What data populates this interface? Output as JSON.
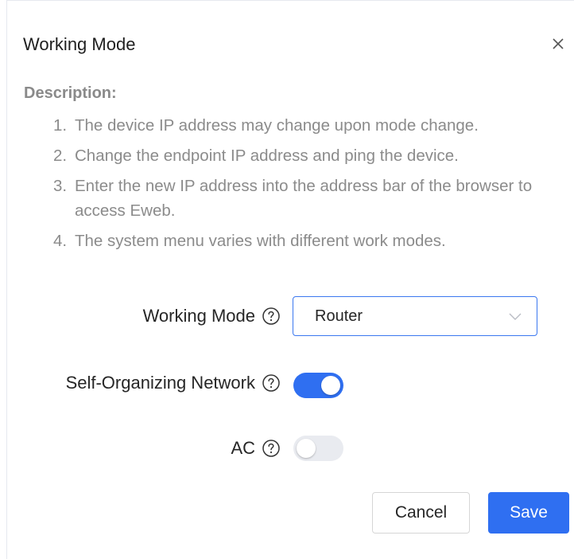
{
  "dialog": {
    "title": "Working Mode",
    "close_label": "×"
  },
  "description": {
    "heading": "Description:",
    "items": [
      {
        "num": "1.",
        "text": "The device IP address may change upon mode change."
      },
      {
        "num": "2.",
        "text": "Change the endpoint IP address and ping the device."
      },
      {
        "num": "3.",
        "text": "Enter the new IP address into the address bar of the browser to access Eweb."
      },
      {
        "num": "4.",
        "text": "The system menu varies with different work modes."
      }
    ]
  },
  "form": {
    "working_mode": {
      "label": "Working Mode",
      "value": "Router",
      "icon": "question-circle-icon"
    },
    "self_organizing": {
      "label": "Self-Organizing Network",
      "enabled": true,
      "icon": "question-circle-icon"
    },
    "ac": {
      "label": "AC",
      "enabled": false,
      "icon": "question-circle-icon"
    }
  },
  "buttons": {
    "cancel": "Cancel",
    "save": "Save"
  },
  "colors": {
    "primary": "#2f6ff1",
    "toggle_off": "#e9ebf0",
    "description_text": "#8b8b8b"
  }
}
